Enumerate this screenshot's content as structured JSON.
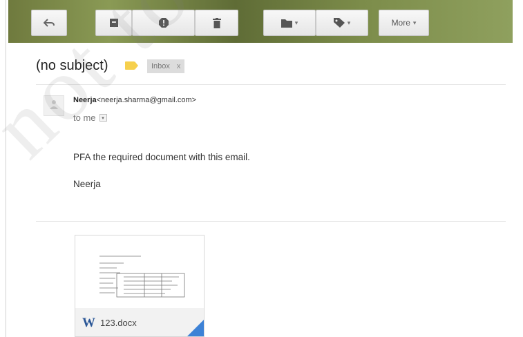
{
  "toolbar": {
    "buttons": [
      {
        "name": "reply-button",
        "icon": "reply-icon"
      },
      {
        "name": "archive-button",
        "icon": "archive-icon"
      },
      {
        "name": "report-spam-button",
        "icon": "report-spam-icon"
      },
      {
        "name": "delete-button",
        "icon": "trash-icon"
      },
      {
        "name": "move-to-button",
        "icon": "folder-icon"
      },
      {
        "name": "labels-button",
        "icon": "label-tag-icon"
      }
    ],
    "more_label": "More",
    "caret": "▾"
  },
  "message": {
    "subject": "(no subject)",
    "label_color": "#f6d04d",
    "label_chip": "Inbox",
    "label_chip_close": "x",
    "sender_name": "Neerja",
    "sender_email": "<neerja.sharma@gmail.com>",
    "to_text": "to me",
    "to_dropdown": "▾",
    "body_line1": "PFA the required document with this email.",
    "signature": "Neerja"
  },
  "attachment": {
    "file_icon": "W",
    "file_name": "123.docx",
    "fold_color": "#3d82d6"
  },
  "watermark": {
    "text": "not to be"
  }
}
